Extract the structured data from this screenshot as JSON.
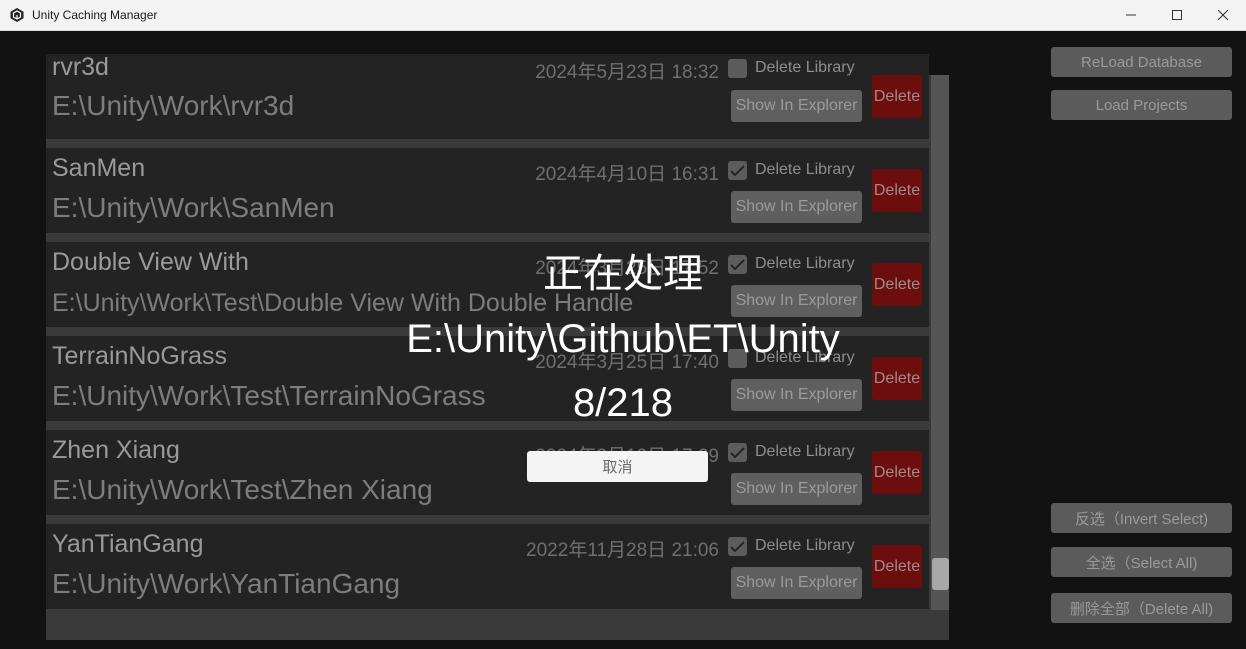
{
  "window": {
    "title": "Unity Caching Manager",
    "app_icon": "unity-logo-icon",
    "controls": [
      "minimize-icon",
      "maximize-icon",
      "close-icon"
    ]
  },
  "sidebar": {
    "reload_label": "ReLoad Database",
    "load_label": "Load Projects",
    "invert_label": "反选（Invert Select)",
    "select_all_label": "全选（Select All)",
    "delete_all_label": "删除全部（Delete All)"
  },
  "row_common": {
    "delete_library_label": "Delete Library",
    "show_in_explorer_label": "Show In Explorer",
    "delete_label": "Delete"
  },
  "projects": [
    {
      "name": "rvr3d",
      "path": "E:\\Unity\\Work\\rvr3d",
      "date": "2024年5月23日 18:32",
      "delete_library": false
    },
    {
      "name": "SanMen",
      "path": "E:\\Unity\\Work\\SanMen",
      "date": "2024年4月10日 16:31",
      "delete_library": true
    },
    {
      "name": "Double View With",
      "path": "E:\\Unity\\Work\\Test\\Double View With Double Handle",
      "date": "2024年3月25日 17:52",
      "delete_library": true
    },
    {
      "name": "TerrainNoGrass",
      "path": "E:\\Unity\\Work\\Test\\TerrainNoGrass",
      "date": "2024年3月25日 17:40",
      "delete_library": false
    },
    {
      "name": "Zhen Xiang",
      "path": "E:\\Unity\\Work\\Test\\Zhen Xiang",
      "date": "2024年3月19日 17:09",
      "delete_library": true
    },
    {
      "name": "YanTianGang",
      "path": "E:\\Unity\\Work\\YanTianGang",
      "date": "2022年11月28日 21:06",
      "delete_library": true
    }
  ],
  "overlay": {
    "status": "正在处理",
    "current_path": "E:\\Unity\\Github\\ET\\Unity",
    "progress": "8/218",
    "cancel_label": "取消"
  },
  "colors": {
    "background": "#121212",
    "row": "#232323",
    "delete_button": "#6d0e0e",
    "overlay_text": "#ffffff"
  }
}
